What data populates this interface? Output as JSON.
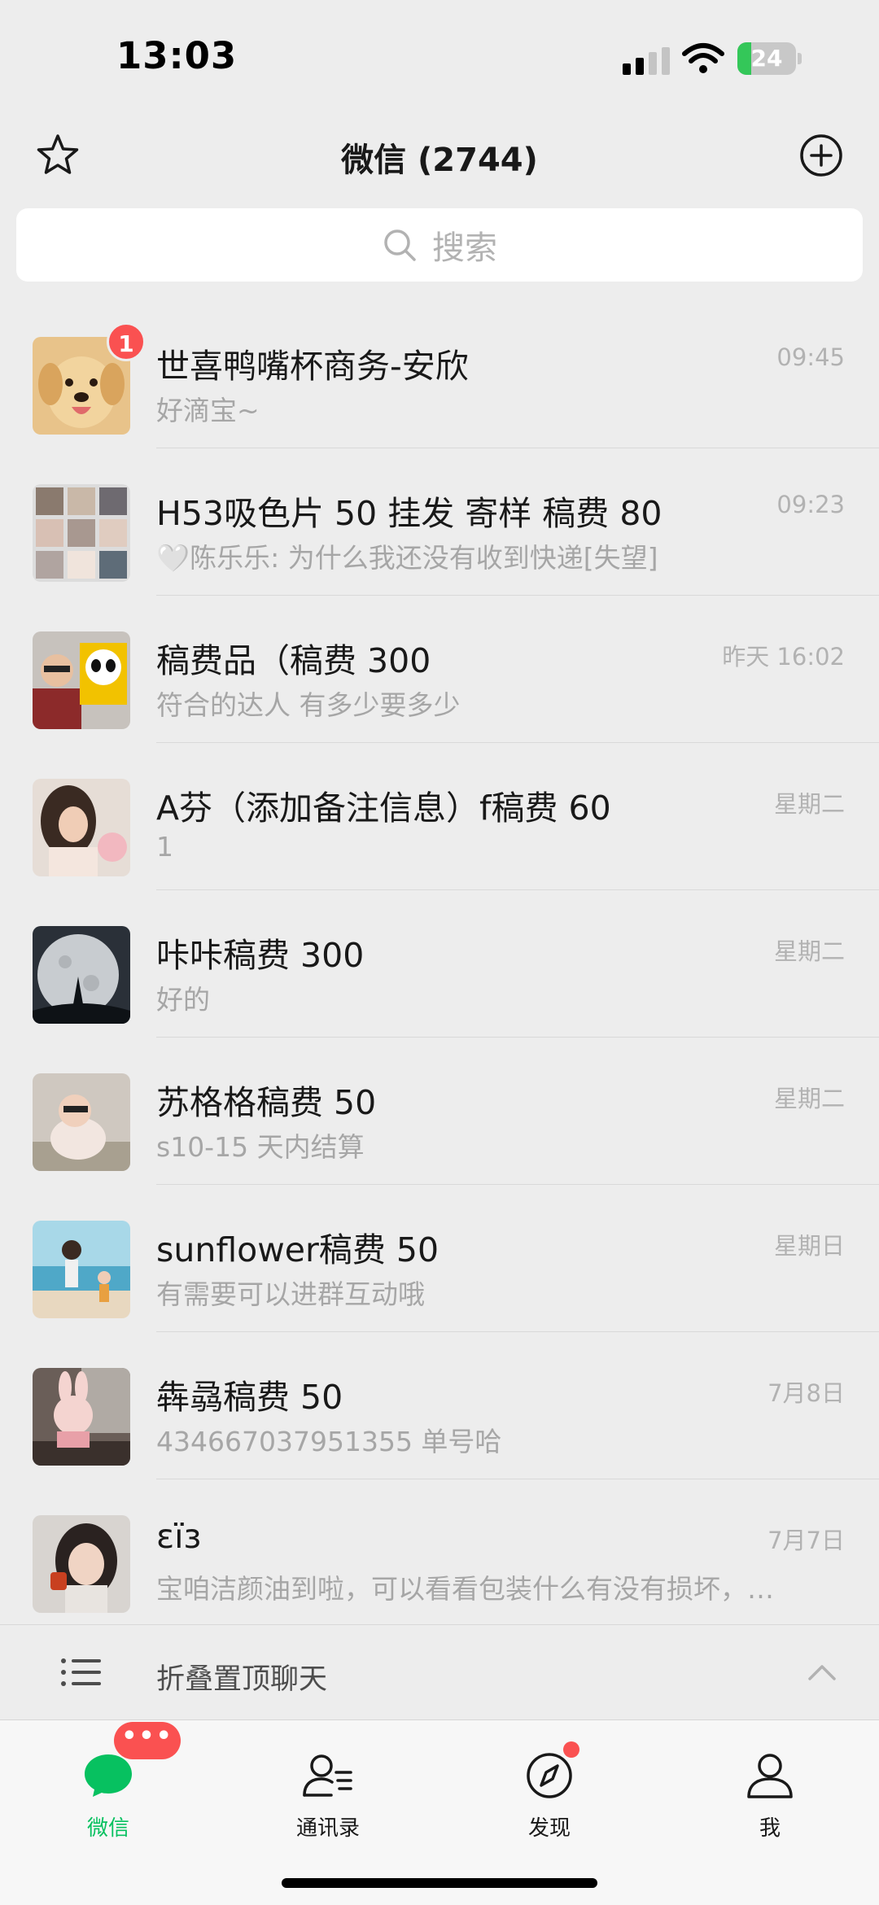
{
  "status_bar": {
    "time": "13:03",
    "battery": "24",
    "battery_level": 0.24
  },
  "header": {
    "title": "微信 (2744)"
  },
  "search": {
    "placeholder": "搜索"
  },
  "chats": [
    {
      "name": "世喜鸭嘴杯商务-安欣",
      "time": "09:45",
      "preview": "好滴宝~",
      "badge": "1"
    },
    {
      "name": "H53吸色片 50 挂发 寄样 稿费 80",
      "time": "09:23",
      "preview": "🤍陈乐乐: 为什么我还没有收到快递[失望]"
    },
    {
      "name": "稿费品（稿费 300",
      "time": "昨天 16:02",
      "preview": "符合的达人 有多少要多少"
    },
    {
      "name": "A芬（添加备注信息）f稿费 60",
      "time": "星期二",
      "preview": "1"
    },
    {
      "name": "咔咔稿费 300",
      "time": "星期二",
      "preview": "好的"
    },
    {
      "name": "苏格格稿费 50",
      "time": "星期二",
      "preview": "s10-15 天内结算"
    },
    {
      "name": "sunflower稿费 50",
      "time": "星期日",
      "preview": "有需要可以进群互动哦"
    },
    {
      "name": "犇骉稿费 50",
      "time": "7月8日",
      "preview": " 434667037951355 单号哈"
    },
    {
      "name": "ɛïɜ",
      "time": "7月7日",
      "preview": "宝咱洁颜油到啦，可以看看包装什么有没有损坏，…"
    }
  ],
  "fold_bar": {
    "label": "折叠置顶聊天"
  },
  "tabs": [
    {
      "label": "微信",
      "icon": "chat-icon",
      "active": true
    },
    {
      "label": "通讯录",
      "icon": "contacts-icon"
    },
    {
      "label": "发现",
      "icon": "compass-icon"
    },
    {
      "label": "我",
      "icon": "person-icon"
    }
  ],
  "tab_badge": "•••",
  "colors": {
    "accent": "#07c160",
    "badge": "#fa5151",
    "background": "#ededed"
  }
}
